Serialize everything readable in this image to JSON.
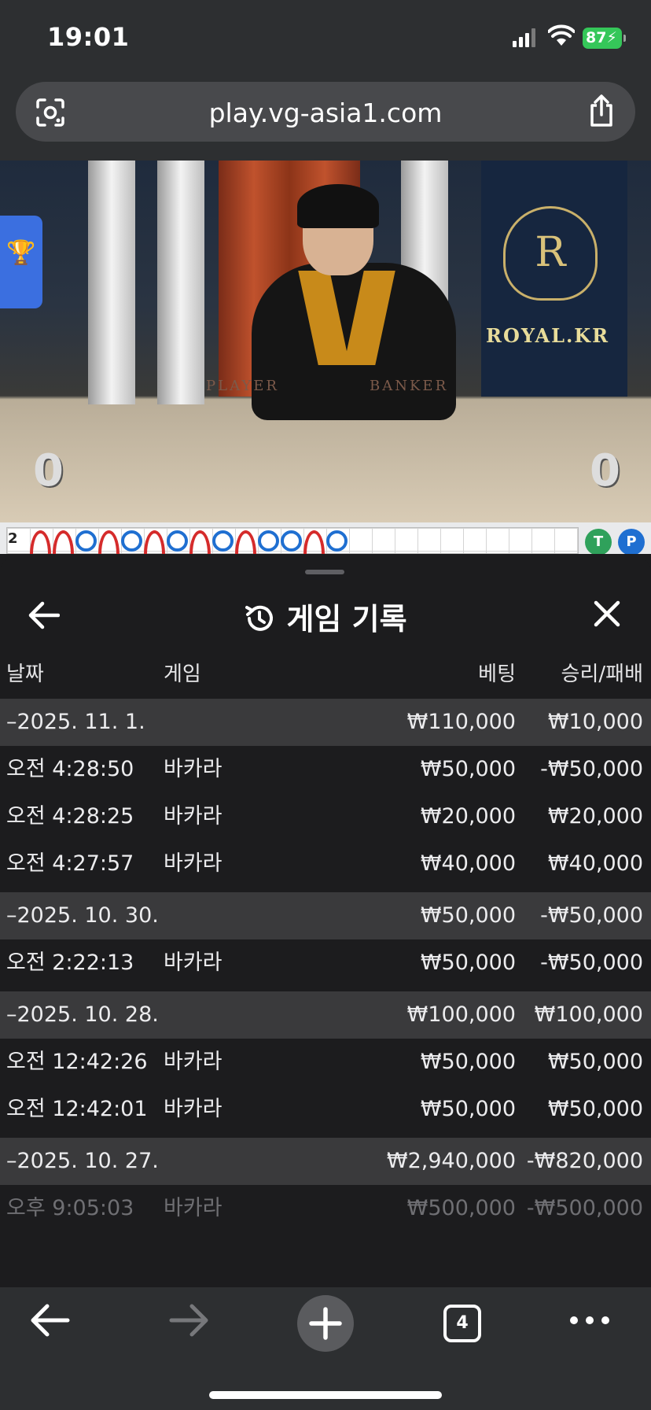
{
  "status_bar": {
    "time": "19:01",
    "battery": "87"
  },
  "browser": {
    "url": "play.vg-asia1.com",
    "tab_count": "4"
  },
  "video": {
    "player_label": "PLAYER",
    "banker_label": "BANKER",
    "player_score": "0",
    "banker_score": "0",
    "brand": "ROYAL.KR",
    "crest_letter": "R"
  },
  "roadmap": {
    "count": "2",
    "results": [
      "B",
      "B",
      "R",
      "B",
      "R",
      "B",
      "R",
      "B",
      "R",
      "B",
      "R",
      "R",
      "B",
      "R"
    ],
    "colors": {
      "banker": "#d52b2b",
      "player": "#1f6fd1"
    },
    "tie_label": "T",
    "p_label": "P"
  },
  "sheet": {
    "title": "게임 기록",
    "columns": {
      "date": "날짜",
      "game": "게임",
      "bet": "베팅",
      "win_loss": "승리/패배"
    },
    "groups": [
      {
        "date": "–2025. 11. 1.",
        "bet": "₩110,000",
        "result": "₩10,000",
        "items": [
          {
            "time": "오전 4:28:50",
            "game": "바카라",
            "bet": "₩50,000",
            "result": "-₩50,000"
          },
          {
            "time": "오전 4:28:25",
            "game": "바카라",
            "bet": "₩20,000",
            "result": "₩20,000"
          },
          {
            "time": "오전 4:27:57",
            "game": "바카라",
            "bet": "₩40,000",
            "result": "₩40,000"
          }
        ]
      },
      {
        "date": "–2025. 10. 30.",
        "bet": "₩50,000",
        "result": "-₩50,000",
        "items": [
          {
            "time": "오전 2:22:13",
            "game": "바카라",
            "bet": "₩50,000",
            "result": "-₩50,000"
          }
        ]
      },
      {
        "date": "–2025. 10. 28.",
        "bet": "₩100,000",
        "result": "₩100,000",
        "items": [
          {
            "time": "오전 12:42:26",
            "game": "바카라",
            "bet": "₩50,000",
            "result": "₩50,000"
          },
          {
            "time": "오전 12:42:01",
            "game": "바카라",
            "bet": "₩50,000",
            "result": "₩50,000"
          }
        ]
      },
      {
        "date": "–2025. 10. 27.",
        "bet": "₩2,940,000",
        "result": "-₩820,000",
        "items": [
          {
            "time": "오후 9:05:03",
            "game": "바카라",
            "bet": "₩500,000",
            "result": "-₩500,000"
          }
        ]
      }
    ]
  },
  "icons": {
    "back": "arrow-left-icon",
    "history": "history-icon",
    "close": "close-icon",
    "lens": "lens-icon",
    "share": "share-icon"
  }
}
